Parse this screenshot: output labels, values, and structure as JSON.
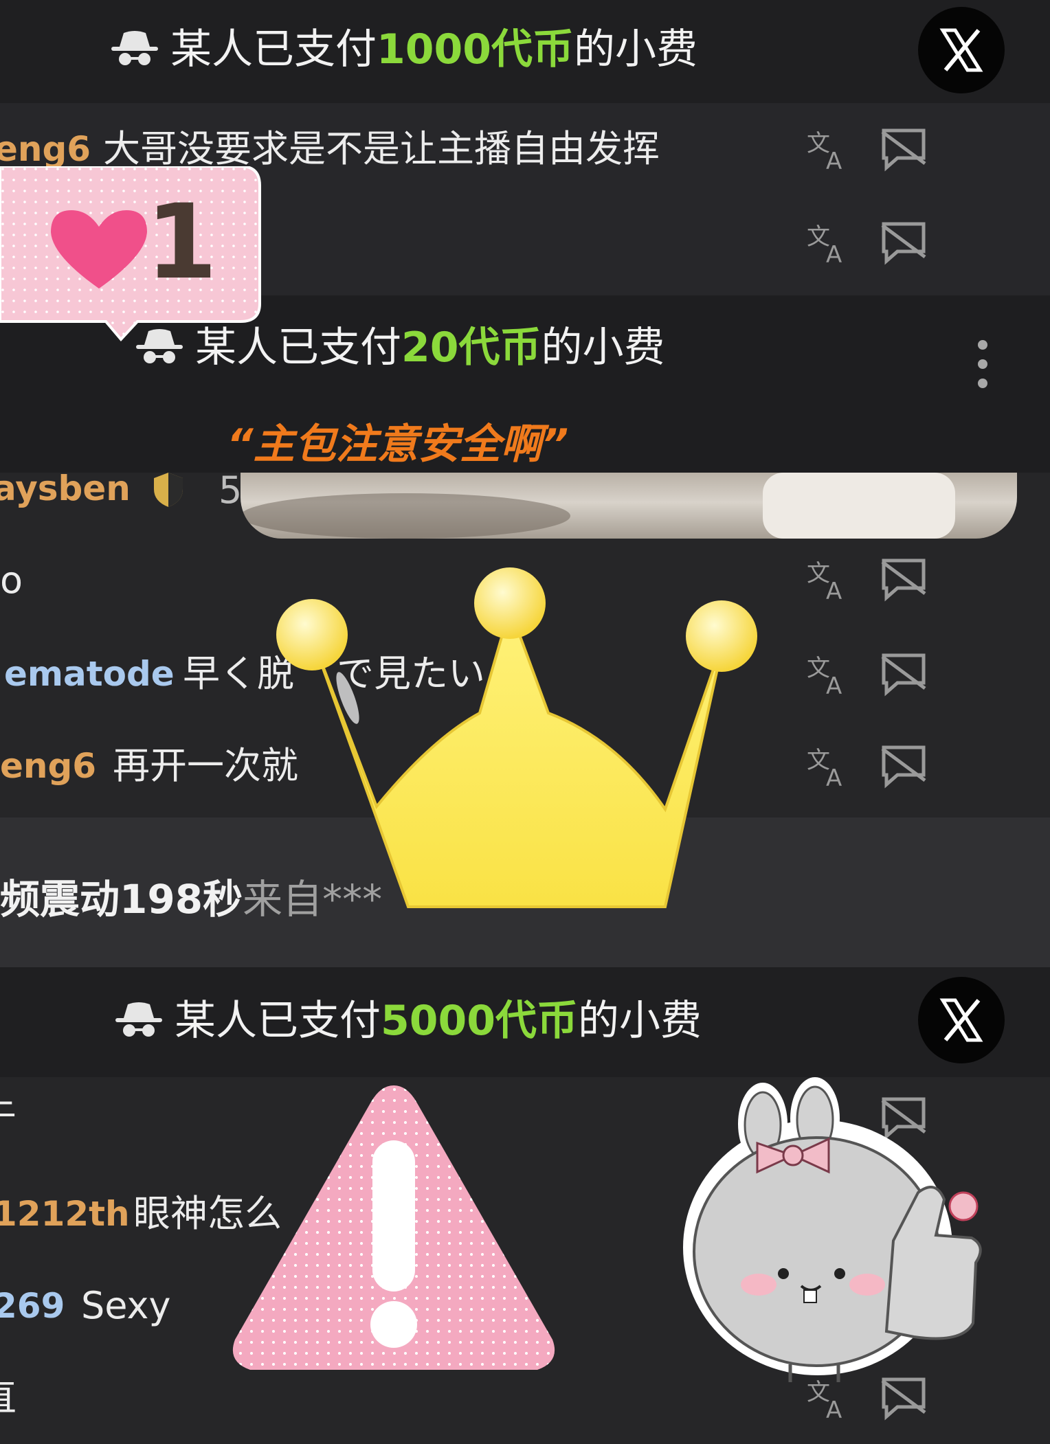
{
  "tips": [
    {
      "prefix": "某人已支付",
      "amount": "1000代币",
      "suffix": "的小费"
    },
    {
      "prefix": "某人已支付",
      "amount": "20代币",
      "suffix": "的小费",
      "message": "“主包注意安全啊”"
    },
    {
      "prefix": "某人已支付",
      "amount": "5000代币",
      "suffix": "的小费"
    }
  ],
  "messages": [
    {
      "user": "eng6",
      "text": "大哥没要求是不是让主播自由发挥"
    },
    {
      "user": "aysben",
      "text": "5"
    },
    {
      "user": "",
      "text": "o"
    },
    {
      "user": "ematode",
      "text": "早く脱"
    },
    {
      "user": "",
      "text": "で見たい"
    },
    {
      "user": "eng6",
      "text": "再开一次就"
    },
    {
      "user": "1212th",
      "text": "眼神怎么"
    },
    {
      "user": "269",
      "text": "Sexy"
    },
    {
      "user": "",
      "text": "于"
    },
    {
      "user": "",
      "text": "直"
    }
  ],
  "vibration": {
    "text": "频震动198秒",
    "from": "来自***"
  },
  "like_badge": {
    "count": "1"
  },
  "icons": {
    "translate": "translate-icon",
    "hide": "hide-chat-icon",
    "close": "x-close-icon",
    "more": "more-vertical-icon",
    "spy": "incognito-icon"
  },
  "colors": {
    "amount": "#8bd93b",
    "tip_message": "#f07a1c",
    "username_orange": "#e0a25a",
    "username_blue": "#a9c9ee",
    "badge_pink": "#f7c7d5"
  }
}
